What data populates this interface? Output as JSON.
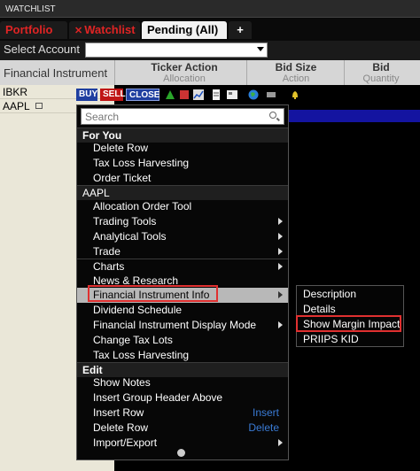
{
  "window": {
    "title": "WATCHLIST"
  },
  "tabs": [
    {
      "label": "Portfolio"
    },
    {
      "label": "Watchlist",
      "close": "✕"
    },
    {
      "label": "Pending (All)"
    },
    {
      "label": "+"
    }
  ],
  "account": {
    "label": "Select Account",
    "value": ""
  },
  "columns": {
    "instrument": "Financial Instrument",
    "ticker_action": {
      "title": "Ticker Action",
      "sub": "Allocation"
    },
    "bid_size": {
      "title": "Bid Size",
      "sub": "Action"
    },
    "bid": {
      "title": "Bid",
      "sub": "Quantity"
    }
  },
  "rows": [
    {
      "symbol": "IBKR"
    },
    {
      "symbol": "AAPL"
    }
  ],
  "order_buttons": {
    "buy": "BUY",
    "sell": "SELL",
    "close": "CLOSE"
  },
  "menu": {
    "search_placeholder": "Search",
    "sections": {
      "for_you": "For You",
      "aapl": "AAPL",
      "edit": "Edit"
    },
    "items": {
      "delete_row": "Delete Row",
      "tax_loss": "Tax Loss Harvesting",
      "order_ticket": "Order Ticket",
      "alloc_tool": "Allocation Order Tool",
      "trading_tools": "Trading Tools",
      "analytical_tools": "Analytical Tools",
      "trade": "Trade",
      "charts": "Charts",
      "news": "News & Research",
      "fin_info": "Financial Instrument Info",
      "dividend": "Dividend Schedule",
      "display_mode": "Financial Instrument Display Mode",
      "change_tax": "Change Tax Lots",
      "tax_loss2": "Tax Loss Harvesting",
      "show_notes": "Show Notes",
      "insert_group": "Insert Group Header Above",
      "insert_row": "Insert Row",
      "insert_row_sc": "Insert",
      "delete_row2": "Delete Row",
      "delete_row2_sc": "Delete",
      "import_export": "Import/Export"
    }
  },
  "submenu": {
    "description": "Description",
    "details": "Details",
    "margin": "Show Margin Impact",
    "priips": "PRIIPS KID"
  },
  "colors": {
    "highlight_box": "#e03030",
    "tab_active_text": "#e02424",
    "shortcut": "#3a7bd5"
  }
}
